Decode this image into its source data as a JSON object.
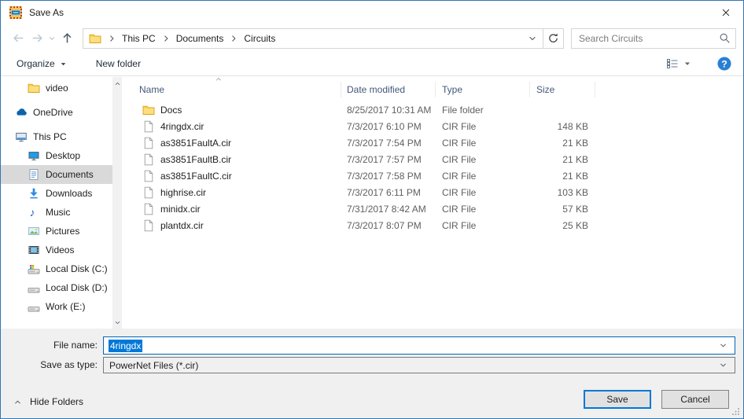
{
  "window": {
    "title": "Save As"
  },
  "navbar": {
    "breadcrumb": {
      "segments": [
        "This PC",
        "Documents",
        "Circuits"
      ]
    },
    "search": {
      "placeholder": "Search Circuits"
    }
  },
  "toolbar": {
    "organize_label": "Organize",
    "new_folder_label": "New folder"
  },
  "sidebar": {
    "items": [
      {
        "label": "video",
        "icon": "folder",
        "indent": 1
      },
      {
        "label": "OneDrive",
        "icon": "onedrive",
        "indent": 0,
        "gap": true
      },
      {
        "label": "This PC",
        "icon": "thispc",
        "indent": 0,
        "gap": true
      },
      {
        "label": "Desktop",
        "icon": "desktop",
        "indent": 1
      },
      {
        "label": "Documents",
        "icon": "documents",
        "indent": 1,
        "selected": true
      },
      {
        "label": "Downloads",
        "icon": "downloads",
        "indent": 1
      },
      {
        "label": "Music",
        "icon": "music",
        "indent": 1
      },
      {
        "label": "Pictures",
        "icon": "pictures",
        "indent": 1
      },
      {
        "label": "Videos",
        "icon": "videos",
        "indent": 1
      },
      {
        "label": "Local Disk (C:)",
        "icon": "disk-win",
        "indent": 1
      },
      {
        "label": "Local Disk (D:)",
        "icon": "disk",
        "indent": 1
      },
      {
        "label": "Work (E:)",
        "icon": "disk",
        "indent": 1
      }
    ]
  },
  "filelist": {
    "columns": [
      "Name",
      "Date modified",
      "Type",
      "Size"
    ],
    "rows": [
      {
        "name": "Docs",
        "icon": "folder",
        "date": "8/25/2017 10:31 AM",
        "type": "File folder",
        "size": ""
      },
      {
        "name": "4ringdx.cir",
        "icon": "file",
        "date": "7/3/2017 6:10 PM",
        "type": "CIR File",
        "size": "148 KB"
      },
      {
        "name": "as3851FaultA.cir",
        "icon": "file",
        "date": "7/3/2017 7:54 PM",
        "type": "CIR File",
        "size": "21 KB"
      },
      {
        "name": "as3851FaultB.cir",
        "icon": "file",
        "date": "7/3/2017 7:57 PM",
        "type": "CIR File",
        "size": "21 KB"
      },
      {
        "name": "as3851FaultC.cir",
        "icon": "file",
        "date": "7/3/2017 7:58 PM",
        "type": "CIR File",
        "size": "21 KB"
      },
      {
        "name": "highrise.cir",
        "icon": "file",
        "date": "7/3/2017 6:11 PM",
        "type": "CIR File",
        "size": "103 KB"
      },
      {
        "name": "minidx.cir",
        "icon": "file",
        "date": "7/31/2017 8:42 AM",
        "type": "CIR File",
        "size": "57 KB"
      },
      {
        "name": "plantdx.cir",
        "icon": "file",
        "date": "7/3/2017 8:07 PM",
        "type": "CIR File",
        "size": "25 KB"
      }
    ]
  },
  "footer": {
    "file_name_label": "File name:",
    "file_name_value": "4ringdx",
    "save_as_type_label": "Save as type:",
    "save_as_type_value": "PowerNet Files (*.cir)",
    "hide_folders_label": "Hide Folders",
    "save_label": "Save",
    "cancel_label": "Cancel"
  },
  "colors": {
    "accent": "#0078d7",
    "window_border": "#2f76b5",
    "selection_bg": "#0078d7",
    "sidebar_selection": "#d9d9d9"
  }
}
